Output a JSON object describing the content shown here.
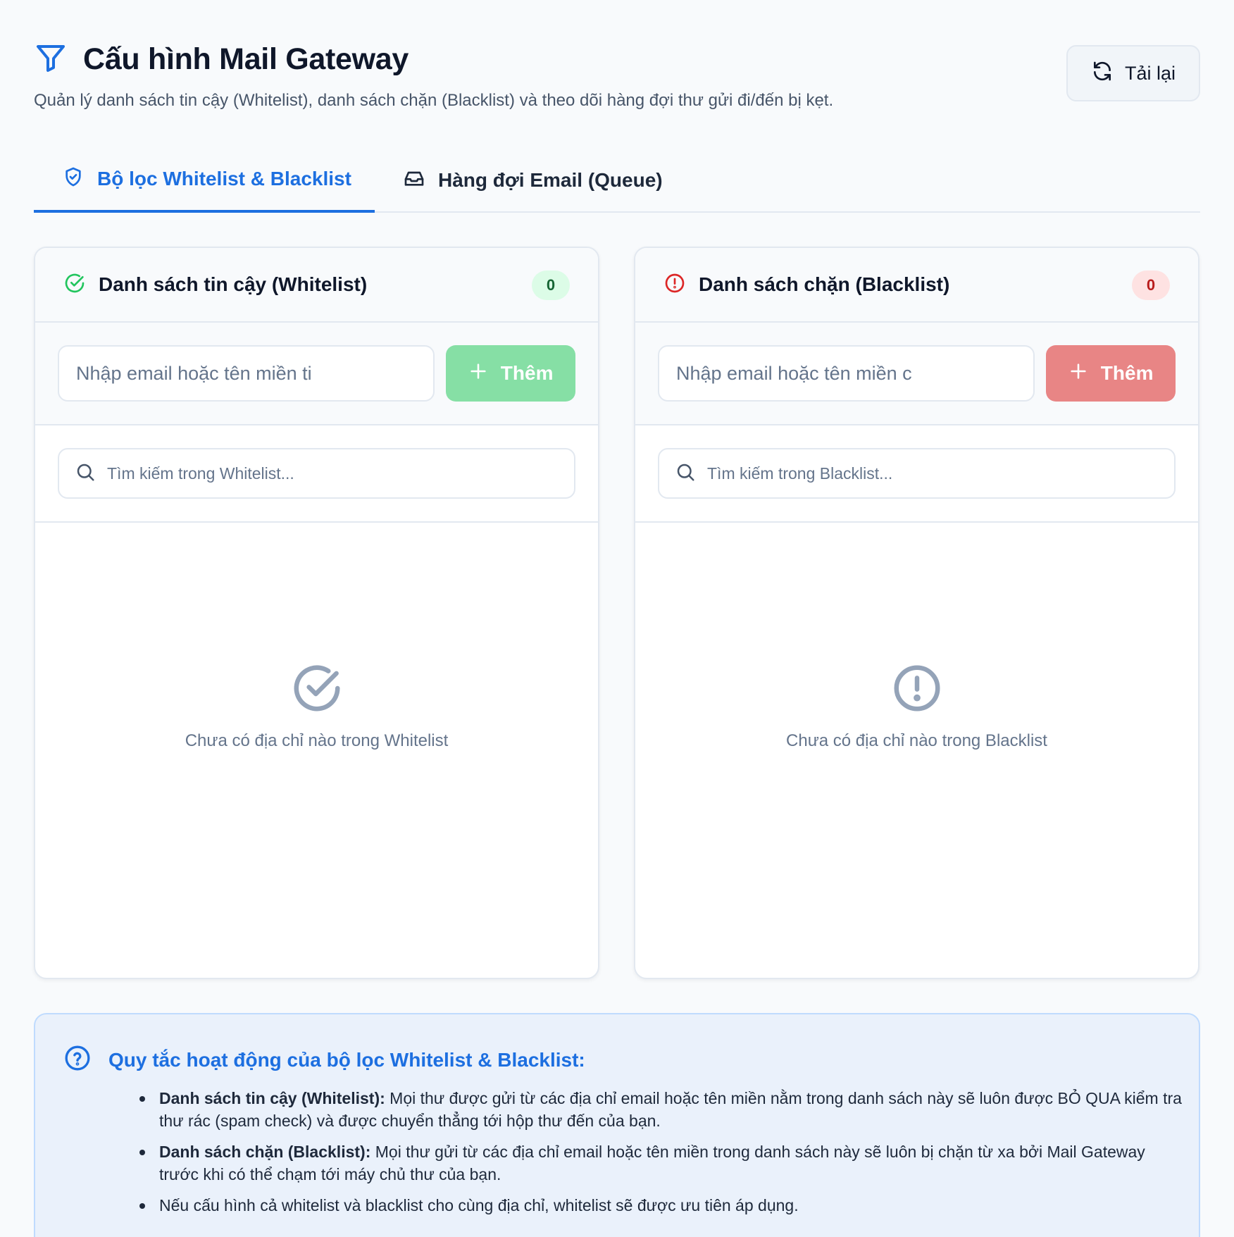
{
  "header": {
    "title": "Cấu hình Mail Gateway",
    "subtitle": "Quản lý danh sách tin cậy (Whitelist), danh sách chặn (Blacklist) và theo dõi hàng đợi thư gửi đi/đến bị kẹt.",
    "reload_label": "Tải lại",
    "title_icon": "filter-icon",
    "reload_icon": "refresh-icon"
  },
  "tabs": [
    {
      "label": "Bộ lọc Whitelist & Blacklist",
      "icon": "shield-check-icon",
      "active": true
    },
    {
      "label": "Hàng đợi Email (Queue)",
      "icon": "inbox-icon",
      "active": false
    }
  ],
  "whitelist": {
    "title": "Danh sách tin cậy (Whitelist)",
    "count": "0",
    "input_placeholder": "Nhập email hoặc tên miền ti",
    "add_label": "Thêm",
    "search_placeholder": "Tìm kiếm trong Whitelist...",
    "empty_text": "Chưa có địa chỉ nào trong Whitelist",
    "accent": "#22c55e"
  },
  "blacklist": {
    "title": "Danh sách chặn (Blacklist)",
    "count": "0",
    "input_placeholder": "Nhập email hoặc tên miền c",
    "add_label": "Thêm",
    "search_placeholder": "Tìm kiếm trong Blacklist...",
    "empty_text": "Chưa có địa chỉ nào trong Blacklist",
    "accent": "#dc2626"
  },
  "info": {
    "title": "Quy tắc hoạt động của bộ lọc Whitelist & Blacklist:",
    "items": [
      {
        "bold": "Danh sách tin cậy (Whitelist):",
        "text": " Mọi thư được gửi từ các địa chỉ email hoặc tên miền nằm trong danh sách này sẽ luôn được BỎ QUA kiểm tra thư rác (spam check) và được chuyển thẳng tới hộp thư đến của bạn."
      },
      {
        "bold": "Danh sách chặn (Blacklist):",
        "text": " Mọi thư gửi từ các địa chỉ email hoặc tên miền trong danh sách này sẽ luôn bị chặn từ xa bởi Mail Gateway trước khi có thể chạm tới máy chủ thư của bạn."
      },
      {
        "bold": "",
        "text": "Nếu cấu hình cả whitelist và blacklist cho cùng địa chỉ, whitelist sẽ được ưu tiên áp dụng."
      }
    ]
  },
  "colors": {
    "primary": "#1d6fe0",
    "success": "#22c55e",
    "danger": "#dc2626"
  }
}
